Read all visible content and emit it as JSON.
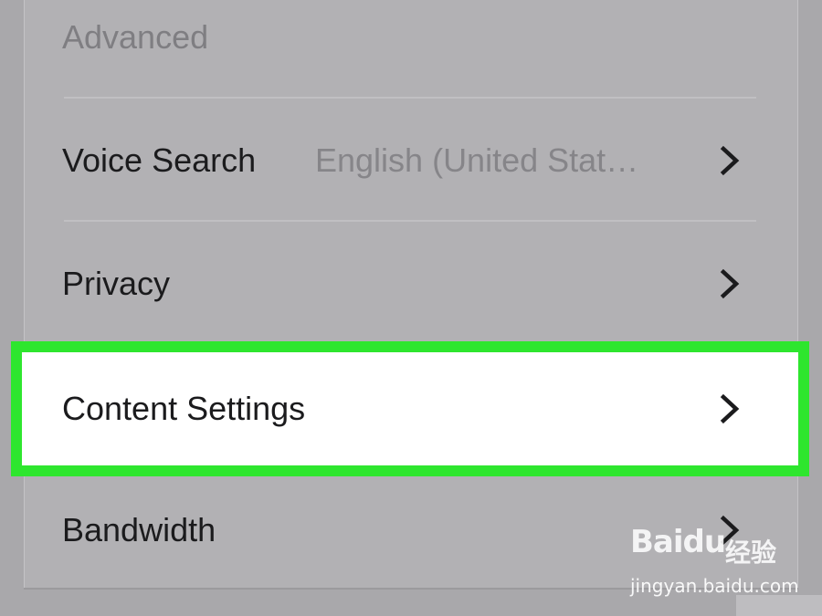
{
  "settings": {
    "section_header": "Advanced",
    "items": [
      {
        "label": "Voice Search",
        "value": "English (United Stat…"
      },
      {
        "label": "Privacy"
      },
      {
        "label": "Content Settings",
        "highlighted": true
      },
      {
        "label": "Bandwidth"
      }
    ]
  },
  "icons": {
    "row_chevron": "chevron-right-icon"
  },
  "colors": {
    "highlight_border": "#2ee62e",
    "selected_row_background": "#ffffff",
    "panel_background": "#b2b1b4"
  },
  "watermark": {
    "logo_text": "Baidu",
    "chinese_text": "经验",
    "url": "jingyan.baidu.com"
  }
}
